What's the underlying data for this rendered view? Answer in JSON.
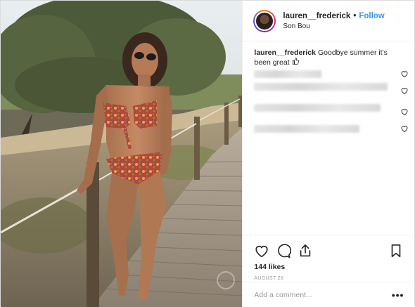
{
  "header": {
    "username": "lauren__frederick",
    "separator": "•",
    "follow_label": "Follow",
    "location": "Son Bou",
    "avatar_icon": "profile-avatar"
  },
  "caption": {
    "username": "lauren__frederick",
    "text": "Goodbye summer it's been great",
    "emoji_icon": "thumbs-up-icon"
  },
  "comments": {
    "count_visible": 4,
    "note": ""
  },
  "actions": {
    "like_icon": "heart-icon",
    "comment_icon": "comment-icon",
    "share_icon": "share-icon",
    "save_icon": "bookmark-icon"
  },
  "likes": "144 likes",
  "date": "AUGUST 26",
  "add_comment": {
    "placeholder": "Add a comment...",
    "more_label": "•••"
  },
  "colors": {
    "link_blue": "#3897f0",
    "text": "#262626",
    "muted": "#999999",
    "border": "#efefef"
  }
}
